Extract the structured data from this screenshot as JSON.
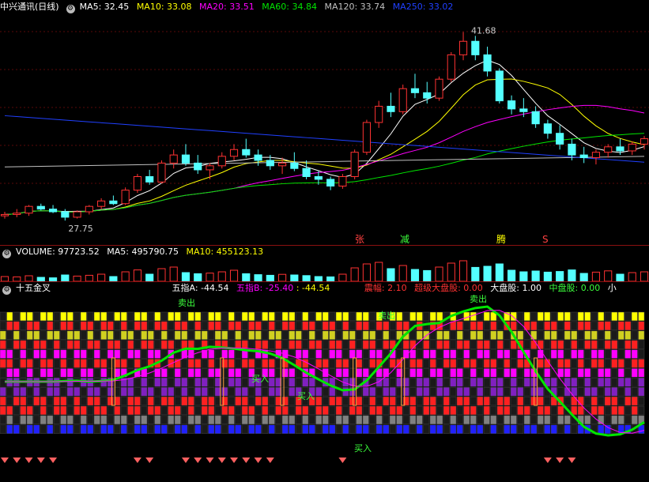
{
  "price_header": {
    "title": "中兴通讯(日线)",
    "ma5": "MA5: 32.45",
    "ma10": "MA10: 33.08",
    "ma20": "MA20: 33.51",
    "ma60": "MA60: 34.84",
    "ma120": "MA120: 33.74",
    "ma250": "MA250: 33.02"
  },
  "price_labels": {
    "high": "41.68",
    "low": "27.75",
    "signal_zhang": "张",
    "signal_jian": "减",
    "signal_teng": "腾",
    "signal_s": "S"
  },
  "volume_header": {
    "volume": "VOLUME: 97723.52",
    "ma5": "MA5: 495790.75",
    "ma10": "MA10: 455123.13"
  },
  "indicator_header": {
    "name": "十五金叉",
    "wuzhi_a": "五指A: -44.54",
    "wuzhi_b": "五指B: -25.40",
    "wuzhi_extra": ": -44.54",
    "zhenfu": "震幅: 2.10",
    "chaoji": "超级大盘股: 0.00",
    "dapan": "大盘股: 1.00",
    "zhongpan": "中盘股: 0.00",
    "xiao": "小"
  },
  "indicator_labels": {
    "sell": "卖出",
    "buy": "买入"
  },
  "colors": {
    "up": "#ff3232",
    "down": "#54ffff",
    "ma5": "#ffffff",
    "ma10": "#ffff00",
    "ma20": "#ff00ff",
    "ma60": "#00e600",
    "ma120": "#c0c0c0",
    "ma250": "#2040ff",
    "pane_border": "#8a1010"
  },
  "chart_data": {
    "type": "candlestick",
    "candles": [
      [
        28.1,
        28.4,
        27.9,
        28.2
      ],
      [
        28.2,
        28.6,
        28.0,
        28.3
      ],
      [
        28.3,
        28.9,
        28.1,
        28.8
      ],
      [
        28.8,
        29.0,
        28.5,
        28.6
      ],
      [
        28.6,
        28.9,
        28.3,
        28.4
      ],
      [
        28.4,
        28.6,
        27.75,
        28.0
      ],
      [
        28.0,
        28.5,
        27.9,
        28.4
      ],
      [
        28.4,
        28.9,
        28.2,
        28.8
      ],
      [
        28.8,
        29.4,
        28.6,
        29.2
      ],
      [
        29.2,
        29.6,
        28.9,
        29.0
      ],
      [
        29.0,
        30.2,
        28.9,
        30.0
      ],
      [
        30.0,
        31.2,
        29.8,
        31.0
      ],
      [
        31.0,
        31.5,
        30.4,
        30.6
      ],
      [
        30.6,
        32.2,
        30.5,
        32.0
      ],
      [
        32.0,
        33.0,
        31.6,
        32.6
      ],
      [
        32.6,
        33.4,
        31.8,
        32.0
      ],
      [
        32.0,
        32.6,
        31.2,
        31.5
      ],
      [
        31.5,
        32.0,
        30.8,
        31.8
      ],
      [
        31.8,
        32.8,
        31.6,
        32.5
      ],
      [
        32.5,
        33.4,
        32.2,
        33.0
      ],
      [
        33.0,
        33.8,
        32.4,
        32.6
      ],
      [
        32.6,
        33.0,
        31.8,
        32.2
      ],
      [
        32.2,
        32.6,
        31.5,
        31.8
      ],
      [
        31.8,
        32.4,
        31.2,
        32.0
      ],
      [
        32.0,
        32.8,
        31.4,
        31.6
      ],
      [
        31.6,
        32.2,
        30.8,
        31.0
      ],
      [
        31.0,
        31.4,
        30.4,
        30.8
      ],
      [
        30.8,
        31.0,
        30.0,
        30.3
      ],
      [
        30.3,
        31.2,
        30.1,
        31.0
      ],
      [
        31.0,
        33.0,
        30.8,
        32.8
      ],
      [
        32.8,
        35.2,
        32.6,
        35.0
      ],
      [
        35.0,
        36.6,
        34.6,
        36.2
      ],
      [
        36.2,
        37.2,
        35.4,
        35.8
      ],
      [
        35.8,
        37.8,
        35.6,
        37.5
      ],
      [
        37.5,
        38.6,
        36.8,
        37.2
      ],
      [
        37.2,
        38.0,
        36.4,
        36.8
      ],
      [
        36.8,
        38.4,
        36.6,
        38.2
      ],
      [
        38.2,
        40.2,
        38.0,
        40.0
      ],
      [
        40.0,
        41.68,
        39.6,
        41.0
      ],
      [
        41.0,
        41.4,
        39.6,
        40.0
      ],
      [
        40.0,
        40.6,
        38.4,
        38.8
      ],
      [
        38.8,
        39.0,
        36.4,
        36.6
      ],
      [
        36.6,
        37.0,
        35.6,
        36.0
      ],
      [
        36.0,
        36.8,
        35.4,
        35.8
      ],
      [
        35.8,
        36.2,
        34.6,
        34.9
      ],
      [
        34.9,
        35.2,
        33.8,
        34.2
      ],
      [
        34.2,
        34.8,
        33.0,
        33.4
      ],
      [
        33.4,
        33.8,
        32.2,
        32.6
      ],
      [
        32.6,
        33.2,
        32.0,
        32.4
      ],
      [
        32.4,
        33.0,
        31.9,
        32.8
      ],
      [
        32.8,
        33.4,
        32.4,
        33.2
      ],
      [
        33.2,
        33.8,
        32.6,
        32.9
      ],
      [
        32.9,
        33.6,
        32.6,
        33.4
      ],
      [
        33.4,
        34.0,
        33.0,
        33.8
      ]
    ],
    "volume": [
      30,
      28,
      35,
      25,
      22,
      40,
      33,
      38,
      45,
      30,
      60,
      72,
      45,
      80,
      90,
      55,
      48,
      52,
      60,
      70,
      48,
      42,
      38,
      44,
      40,
      36,
      30,
      28,
      45,
      85,
      110,
      120,
      80,
      100,
      75,
      68,
      90,
      115,
      130,
      88,
      95,
      110,
      70,
      60,
      65,
      58,
      62,
      72,
      50,
      58,
      66,
      45,
      55,
      60
    ],
    "price_range": [
      27.0,
      43.0
    ]
  }
}
